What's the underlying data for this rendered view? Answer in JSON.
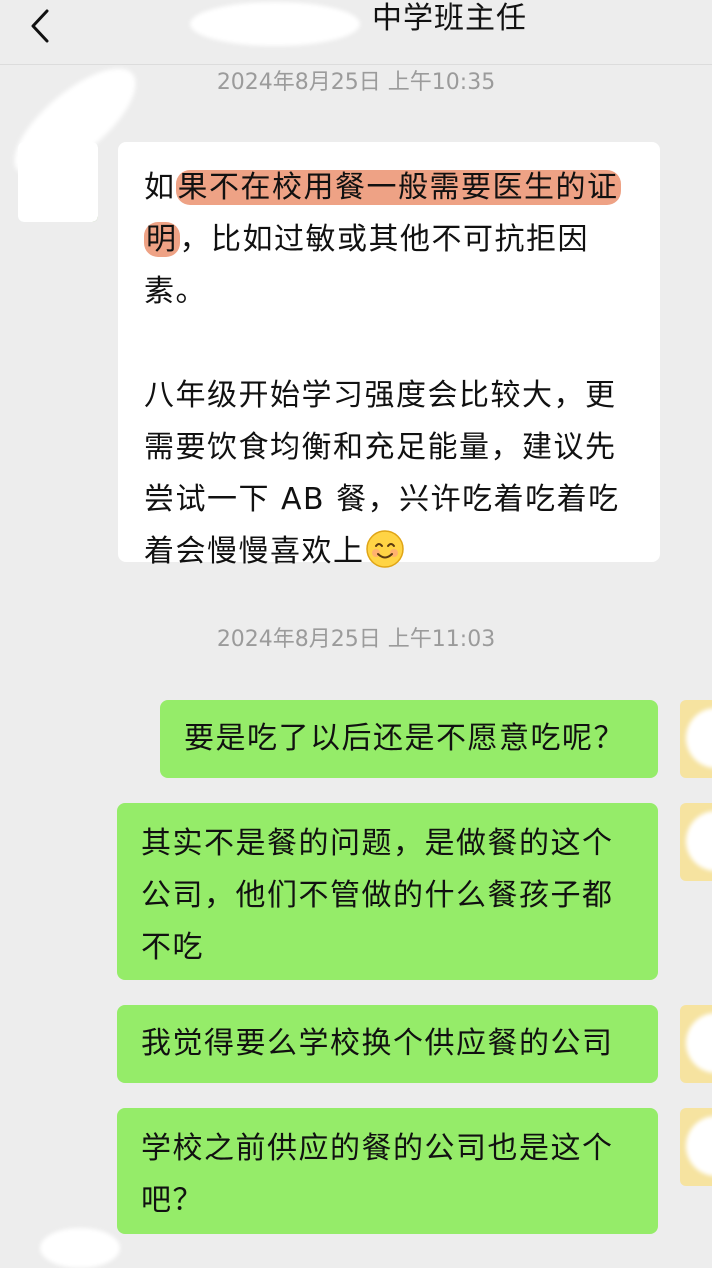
{
  "header": {
    "title": "中学班主任"
  },
  "messages": {
    "timestamp_1": "2024年8月25日 上午10:35",
    "incoming": {
      "part1_pre": "如",
      "part1_highlight_a": "果不在校用餐一般需要医生的证",
      "part1_highlight_b": "明",
      "part1_post": "，比如过敏或其他不可抗拒因素。",
      "part2": "八年级开始学习强度会比较大，更需要饮食均衡和充足能量，建议先尝试一下 AB 餐，兴许吃着吃着吃着会慢慢喜欢上",
      "emoji": "smiling-face-emoji"
    },
    "timestamp_2": "2024年8月25日 上午11:03",
    "outgoing": [
      "要是吃了以后还是不愿意吃呢？",
      "其实不是餐的问题，是做餐的这个公司，他们不管做的什么餐孩子都不吃",
      "我觉得要么学校换个供应餐的公司",
      "学校之前供应的餐的公司也是这个吧？"
    ]
  },
  "colors": {
    "background": "#ededed",
    "incoming_bubble": "#ffffff",
    "outgoing_bubble": "#95ec69",
    "highlight": "#e87e56",
    "timestamp": "#9b9b9b"
  }
}
